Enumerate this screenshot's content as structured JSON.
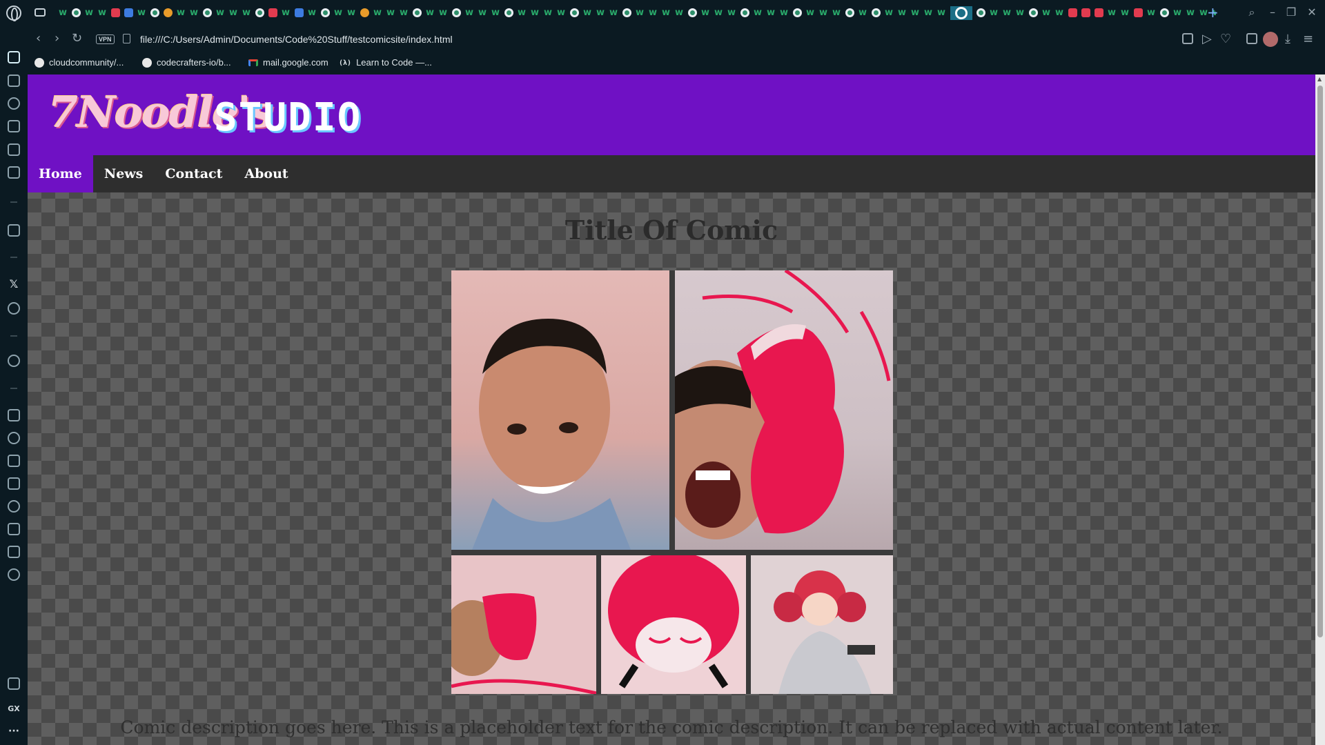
{
  "browser": {
    "url": "file:///C:/Users/Admin/Documents/Code%20Stuff/testcomicsite/index.html",
    "vpn_label": "VPN",
    "bookmarks": [
      {
        "label": "cloudcommunity/...",
        "icon": "github-icon"
      },
      {
        "label": "codecrafters-io/b...",
        "icon": "github-icon"
      },
      {
        "label": "mail.google.com",
        "icon": "gmail-icon"
      },
      {
        "label": "Learn to Code —...",
        "icon": "freecodecamp-icon"
      }
    ],
    "sidebar_texts": {
      "x": "𝕏",
      "gx": "GX",
      "more": "···"
    }
  },
  "site": {
    "logo_script": "7Noodle's",
    "logo_block": "STUDIO",
    "nav": [
      {
        "label": "Home",
        "active": true
      },
      {
        "label": "News",
        "active": false
      },
      {
        "label": "Contact",
        "active": false
      },
      {
        "label": "About",
        "active": false
      }
    ],
    "comic_title": "Title Of Comic",
    "comic_description": "Comic description goes here. This is a placeholder text for the comic description. It can be replaced with actual content later.",
    "colors": {
      "header": "#6f11c4",
      "nav": "#2e2e2e",
      "accent": "#e8174f"
    }
  }
}
